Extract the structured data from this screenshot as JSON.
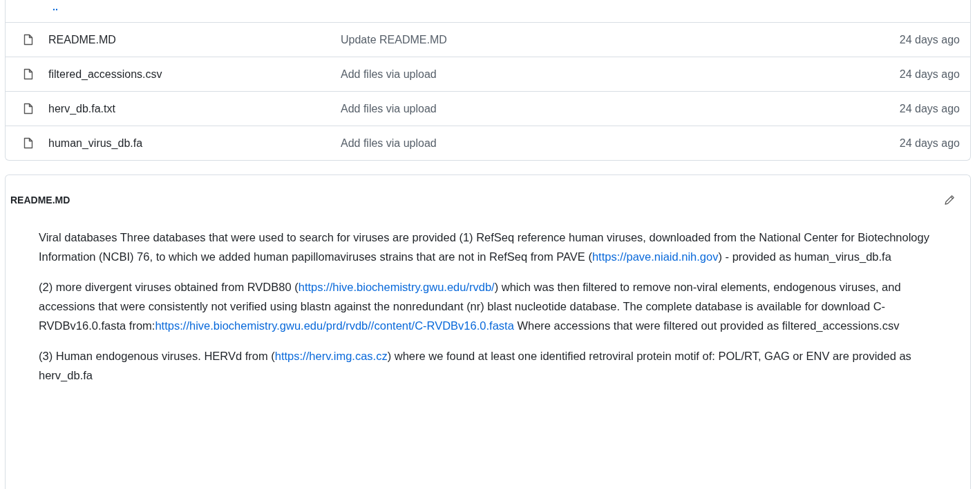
{
  "parent_link": "..",
  "files": [
    {
      "name": "README.MD",
      "message": "Update README.MD",
      "age": "24 days ago"
    },
    {
      "name": "filtered_accessions.csv",
      "message": "Add files via upload",
      "age": "24 days ago"
    },
    {
      "name": "herv_db.fa.txt",
      "message": "Add files via upload",
      "age": "24 days ago"
    },
    {
      "name": "human_virus_db.fa",
      "message": "Add files via upload",
      "age": "24 days ago"
    }
  ],
  "readme": {
    "title": "README.MD",
    "paragraphs": [
      [
        {
          "kind": "text",
          "text": "Viral databases Three databases that were used to search for viruses are provided (1) RefSeq reference human viruses, downloaded from the National Center for Biotechnology Information (NCBI) 76, to which we added human papillomaviruses strains that are not in RefSeq from PAVE ("
        },
        {
          "kind": "link",
          "text": "https://pave.niaid.nih.gov"
        },
        {
          "kind": "text",
          "text": ") - provided as human_virus_db.fa"
        }
      ],
      [
        {
          "kind": "text",
          "text": "(2) more divergent viruses obtained from RVDB80 ("
        },
        {
          "kind": "link",
          "text": "https://hive.biochemistry.gwu.edu/rvdb/"
        },
        {
          "kind": "text",
          "text": ") which was then filtered to remove non-viral elements, endogenous viruses, and accessions that were consistently not verified using blastn against the nonredundant (nr) blast nucleotide database. The complete database is available for download C-RVDBv16.0.fasta from:"
        },
        {
          "kind": "link",
          "text": "https://hive.biochemistry.gwu.edu/prd/rvdb//content/C-RVDBv16.0.fasta"
        },
        {
          "kind": "text",
          "text": " Where accessions that were filtered out provided as filtered_accessions.csv"
        }
      ],
      [
        {
          "kind": "text",
          "text": "(3) Human endogenous viruses. HERVd from ("
        },
        {
          "kind": "link",
          "text": "https://herv.img.cas.cz"
        },
        {
          "kind": "text",
          "text": ") where we found at least one identified retroviral protein motif of: POL/RT, GAG or ENV are provided as herv_db.fa"
        }
      ]
    ]
  }
}
